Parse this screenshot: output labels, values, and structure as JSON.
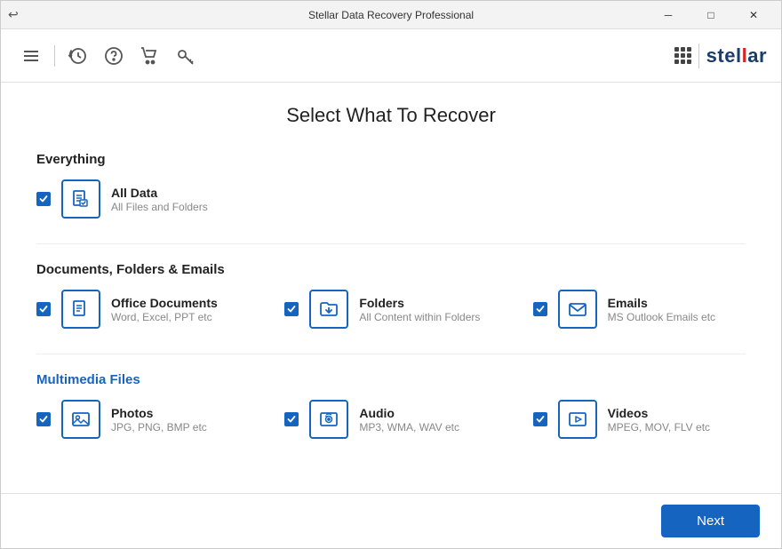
{
  "titleBar": {
    "backIcon": "↩",
    "title": "Stellar Data Recovery Professional",
    "minimizeIcon": "─",
    "maximizeIcon": "□",
    "closeIcon": "✕"
  },
  "toolbar": {
    "hamburgerIcon": "≡",
    "historyIcon": "⊙",
    "helpIcon": "?",
    "cartIcon": "🛒",
    "keyIcon": "🔑",
    "divider": "|",
    "gridIconLabel": "apps-icon",
    "logoText1": "stel",
    "logoHighlight": "l",
    "logoText2": "ar"
  },
  "main": {
    "pageTitle": "Select What To Recover",
    "sections": [
      {
        "id": "everything",
        "title": "Everything",
        "titleColor": "dark",
        "items": [
          {
            "id": "all-data",
            "label": "All Data",
            "description": "All Files and Folders",
            "checked": true,
            "icon": "document"
          }
        ]
      },
      {
        "id": "documents",
        "title": "Documents, Folders & Emails",
        "titleColor": "dark",
        "items": [
          {
            "id": "office-docs",
            "label": "Office Documents",
            "description": "Word, Excel, PPT etc",
            "checked": true,
            "icon": "document"
          },
          {
            "id": "folders",
            "label": "Folders",
            "description": "All Content within Folders",
            "checked": true,
            "icon": "folder"
          },
          {
            "id": "emails",
            "label": "Emails",
            "description": "MS Outlook Emails etc",
            "checked": true,
            "icon": "email"
          }
        ]
      },
      {
        "id": "multimedia",
        "title": "Multimedia Files",
        "titleColor": "blue",
        "items": [
          {
            "id": "photos",
            "label": "Photos",
            "description": "JPG, PNG, BMP etc",
            "checked": true,
            "icon": "photo"
          },
          {
            "id": "audio",
            "label": "Audio",
            "description": "MP3, WMA, WAV etc",
            "checked": true,
            "icon": "audio"
          },
          {
            "id": "videos",
            "label": "Videos",
            "description": "MPEG, MOV, FLV etc",
            "checked": true,
            "icon": "video"
          }
        ]
      }
    ]
  },
  "footer": {
    "nextLabel": "Next"
  }
}
